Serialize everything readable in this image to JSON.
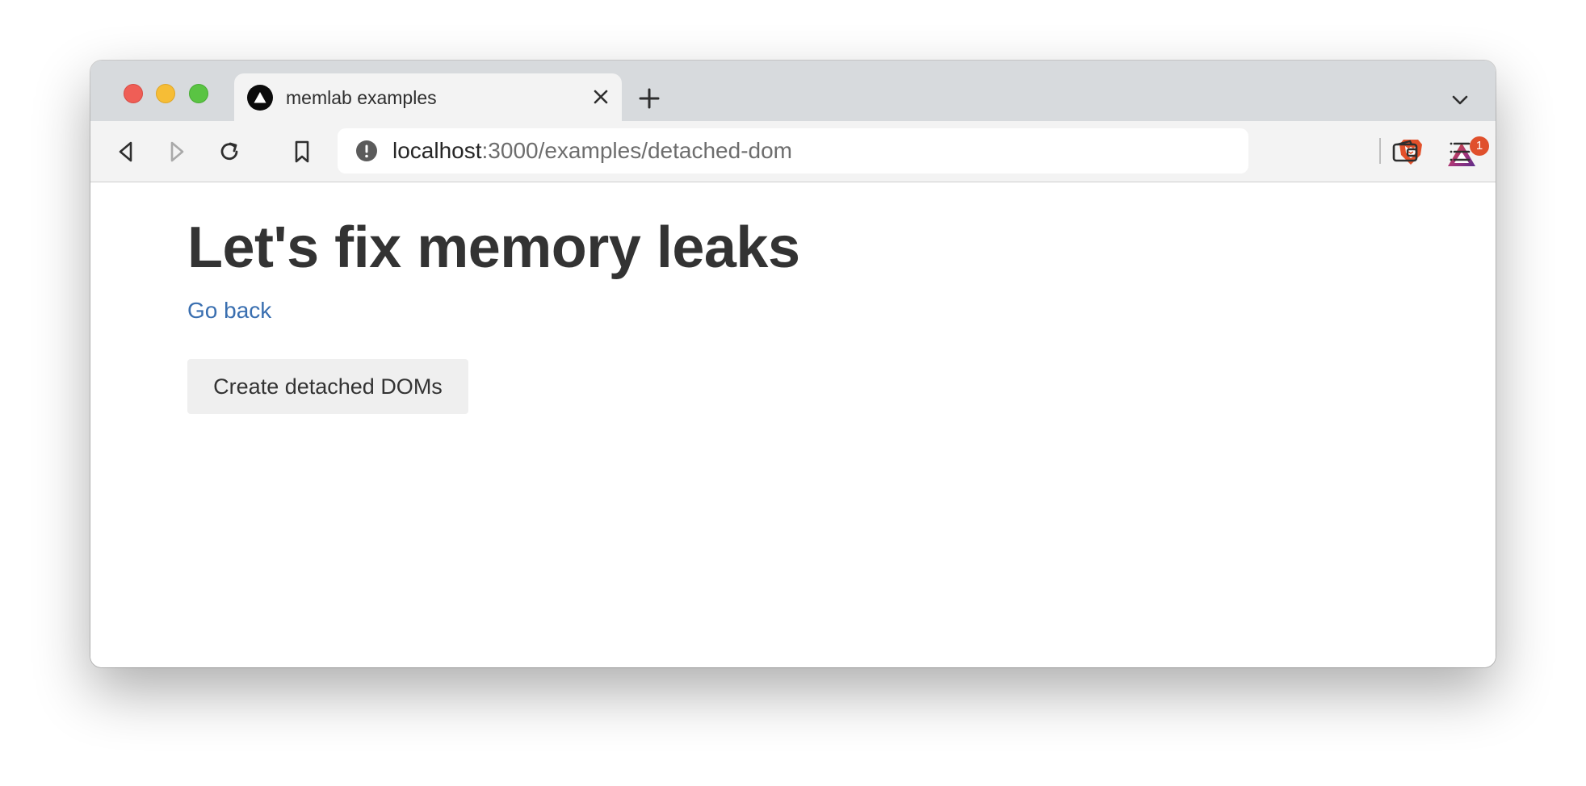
{
  "browser": {
    "tab": {
      "title": "memlab examples",
      "favicon": "triangle-logo-icon"
    },
    "address": {
      "host": "localhost",
      "path": ":3000/examples/detached-dom"
    },
    "rewards_badge": "1"
  },
  "page": {
    "title": "Let's fix memory leaks",
    "go_back_link": "Go back",
    "button_label": "Create detached DOMs"
  },
  "colors": {
    "link": "#3a6fb0",
    "heading": "#333333",
    "button_bg": "#efefef",
    "brave_orange": "#e0502c"
  }
}
